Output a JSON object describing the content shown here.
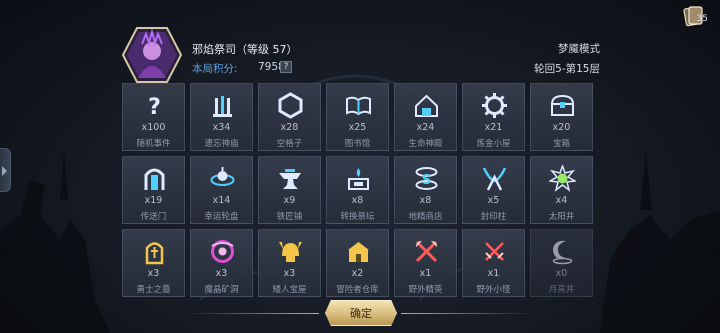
{
  "header": {
    "player_name": "邪焰祭司（等级 57）",
    "score_label": "本局积分:",
    "score_value": "7958",
    "help_mark": "?",
    "mode": "梦魇模式",
    "round": "轮回5-第15层"
  },
  "corner": {
    "count": "35",
    "icon": "cards-icon"
  },
  "tiles": [
    {
      "count": "x100",
      "label": "随机事件",
      "icon": "question-icon"
    },
    {
      "count": "x34",
      "label": "遗忘神庙",
      "icon": "temple-icon"
    },
    {
      "count": "x28",
      "label": "空格子",
      "icon": "hexagon-icon"
    },
    {
      "count": "x25",
      "label": "图书馆",
      "icon": "book-icon"
    },
    {
      "count": "x24",
      "label": "生命神殿",
      "icon": "shrine-icon"
    },
    {
      "count": "x21",
      "label": "炼金小屋",
      "icon": "gear-icon"
    },
    {
      "count": "x20",
      "label": "宝箱",
      "icon": "chest-icon"
    },
    {
      "count": "x19",
      "label": "传送门",
      "icon": "portal-icon"
    },
    {
      "count": "x14",
      "label": "幸运轮盘",
      "icon": "wheel-icon"
    },
    {
      "count": "x9",
      "label": "铁匠铺",
      "icon": "anvil-icon"
    },
    {
      "count": "x8",
      "label": "转换祭坛",
      "icon": "altar-icon"
    },
    {
      "count": "x8",
      "label": "地精商店",
      "icon": "shop-icon"
    },
    {
      "count": "x5",
      "label": "封印柱",
      "icon": "seal-icon"
    },
    {
      "count": "x4",
      "label": "太阳井",
      "icon": "sun-icon"
    },
    {
      "count": "x3",
      "label": "勇士之墓",
      "icon": "tomb-icon"
    },
    {
      "count": "x3",
      "label": "魔晶矿洞",
      "icon": "crystal-icon"
    },
    {
      "count": "x3",
      "label": "矮人宝屋",
      "icon": "helmet-icon"
    },
    {
      "count": "x2",
      "label": "冒险者仓库",
      "icon": "warehouse-icon"
    },
    {
      "count": "x1",
      "label": "野外精英",
      "icon": "axes-icon"
    },
    {
      "count": "x1",
      "label": "野外小怪",
      "icon": "swords-icon"
    },
    {
      "count": "x0",
      "label": "月亮井",
      "icon": "moon-icon"
    }
  ],
  "confirm_label": "确定",
  "colors": {
    "accent_blue": "#5f9fe0",
    "icon_cyan": "#4fd0ff",
    "icon_pink": "#e04fd6",
    "icon_gold": "#f3c548",
    "icon_red": "#ff5a5a",
    "icon_green": "#9be86a"
  }
}
